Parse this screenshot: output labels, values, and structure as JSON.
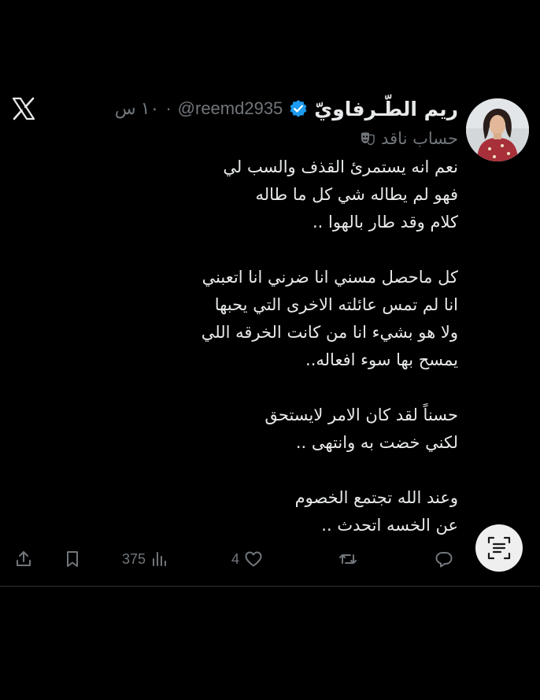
{
  "author": {
    "display_name": "ريم الطّـرفاويّ",
    "handle": "@reemd2935",
    "separator": "·",
    "time": "١٠ س",
    "label": "حساب ناقد",
    "label_icon": "theater-masks-icon",
    "verified": true
  },
  "tweet": {
    "lines": [
      "نعم انه يستمرئ القذف والسب لي",
      "فهو لم يطاله شي كل ما طاله",
      "كلام وقد طار بالهوا ..",
      "",
      "كل ماحصل مسني انا ضرني انا اتعبني",
      "انا لم تمس عائلته الاخرى التي يحبها",
      "ولا هو بشيء انا من كانت الخرقه اللي",
      "يمسح بها سوء افعاله..",
      "",
      "حسناً لقد كان الامر لايستحق",
      "لكني خضت به وانتهى ..",
      "",
      "وعند الله تجتمع الخصوم",
      "عن الخسه اتحدث .."
    ]
  },
  "actions": {
    "views": "375",
    "likes": "4"
  },
  "colors": {
    "background": "#000000",
    "text": "#e7e9ea",
    "secondary": "#71767b",
    "verified": "#1d9bf0",
    "divider": "#2f3336",
    "scan_button_bg": "#efefef"
  },
  "icons": {
    "logo": "x-logo-icon",
    "verified": "verified-badge-icon",
    "share": "share-icon",
    "bookmark": "bookmark-icon",
    "views": "views-icon",
    "like": "heart-icon",
    "retweet": "retweet-icon",
    "reply": "reply-icon",
    "scan": "text-scan-icon"
  }
}
